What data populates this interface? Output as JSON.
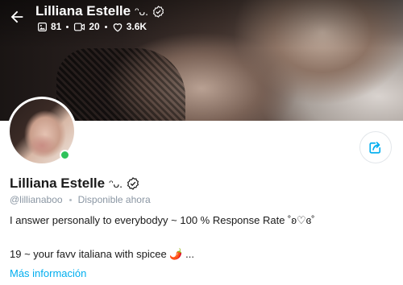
{
  "header": {
    "name": "Lilliana Estelle",
    "name_suffix": "ᵔᴗ.",
    "stats": {
      "photos": "81",
      "videos": "20",
      "likes": "3.6K"
    }
  },
  "profile": {
    "name": "Lilliana Estelle",
    "name_suffix": "ᵔᴗ.",
    "handle": "@lillianaboo",
    "status": "Disponible ahora",
    "bio_line1": "I answer personally to everybodyy ~ 100 % Response Rate ˚ʚ♡ɞ˚",
    "bio_line2": "19 ~ your favv italiana with spicee 🌶️ ...",
    "more_link": "Más información"
  },
  "icons": {
    "back": "arrow-left-icon",
    "photos": "image-icon",
    "videos": "video-icon",
    "likes": "heart-icon",
    "verified": "verified-badge-icon",
    "share": "share-icon"
  },
  "colors": {
    "accent": "#00aeef",
    "online": "#2ec25a",
    "muted": "#8a96a3"
  }
}
